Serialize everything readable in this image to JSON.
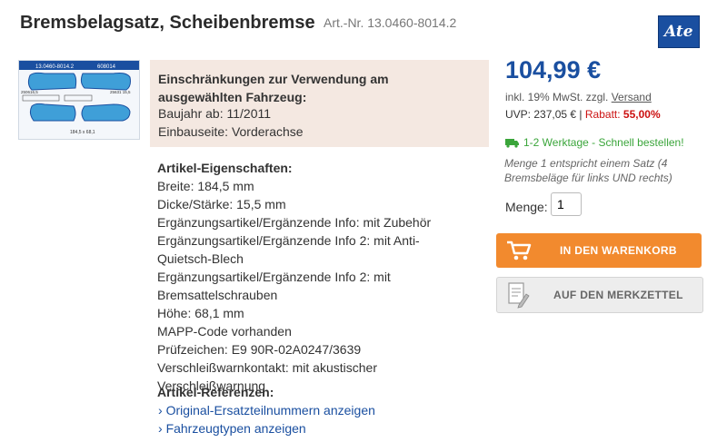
{
  "product": {
    "title": "Bremsbelagsatz, Scheibenbremse",
    "art_nr": "Art.-Nr. 13.0460-8014.2",
    "brand_logo": "Ate"
  },
  "thumbnail": {
    "label_top": "13.0460-8014.2",
    "label_top2": "608014",
    "dim_left": "250616,5",
    "dim_right": "25631 15,5",
    "dim_bottom": "184,5 x 68,1"
  },
  "restrictions": {
    "title": "Einschränkungen zur Verwendung am ausgewählten Fahrzeug:",
    "lines": [
      "Baujahr ab: 11/2011",
      "Einbauseite: Vorderachse"
    ]
  },
  "properties": {
    "heading": "Artikel-Eigenschaften:",
    "items": [
      "Breite: 184,5 mm",
      "Dicke/Stärke: 15,5 mm",
      "Ergänzungsartikel/Ergänzende Info: mit Zubehör",
      "Ergänzungsartikel/Ergänzende Info 2: mit Anti-Quietsch-Blech",
      "Ergänzungsartikel/Ergänzende Info 2: mit Bremsattelschrauben",
      "Höhe: 68,1 mm",
      "MAPP-Code vorhanden",
      "Prüfzeichen: E9 90R-02A0247/3639",
      "Verschleißwarnkontakt: mit akustischer Verschleißwarnung"
    ]
  },
  "references": {
    "heading": "Artikel-Referenzen:",
    "links": [
      "Original-Ersatzteilnummern anzeigen",
      "Fahrzeugtypen anzeigen"
    ]
  },
  "pricing": {
    "price": "104,99 €",
    "tax_prefix": "inkl. 19% MwSt. zzgl.",
    "tax_link": "Versand",
    "uvp": "UVP: 237,05 €",
    "separator": "|",
    "rabatt_label": "Rabatt:",
    "rabatt_value": "55,00%"
  },
  "shipping": {
    "text": "1-2 Werktage - Schnell bestellen!",
    "note": "Menge 1 entspricht einem Satz (4 Bremsbeläge für links UND rechts)"
  },
  "order": {
    "menge_label": "Menge:",
    "menge_value": "1",
    "cart_label": "IN DEN WARENKORB",
    "memo_label": "AUF DEN MERKZETTEL"
  },
  "colors": {
    "accent_blue": "#1a4fa0",
    "cart_orange": "#f28a2e",
    "discount_red": "#cc1111",
    "shipping_green": "#3aa53a",
    "restriction_bg": "#f4e8e1"
  }
}
